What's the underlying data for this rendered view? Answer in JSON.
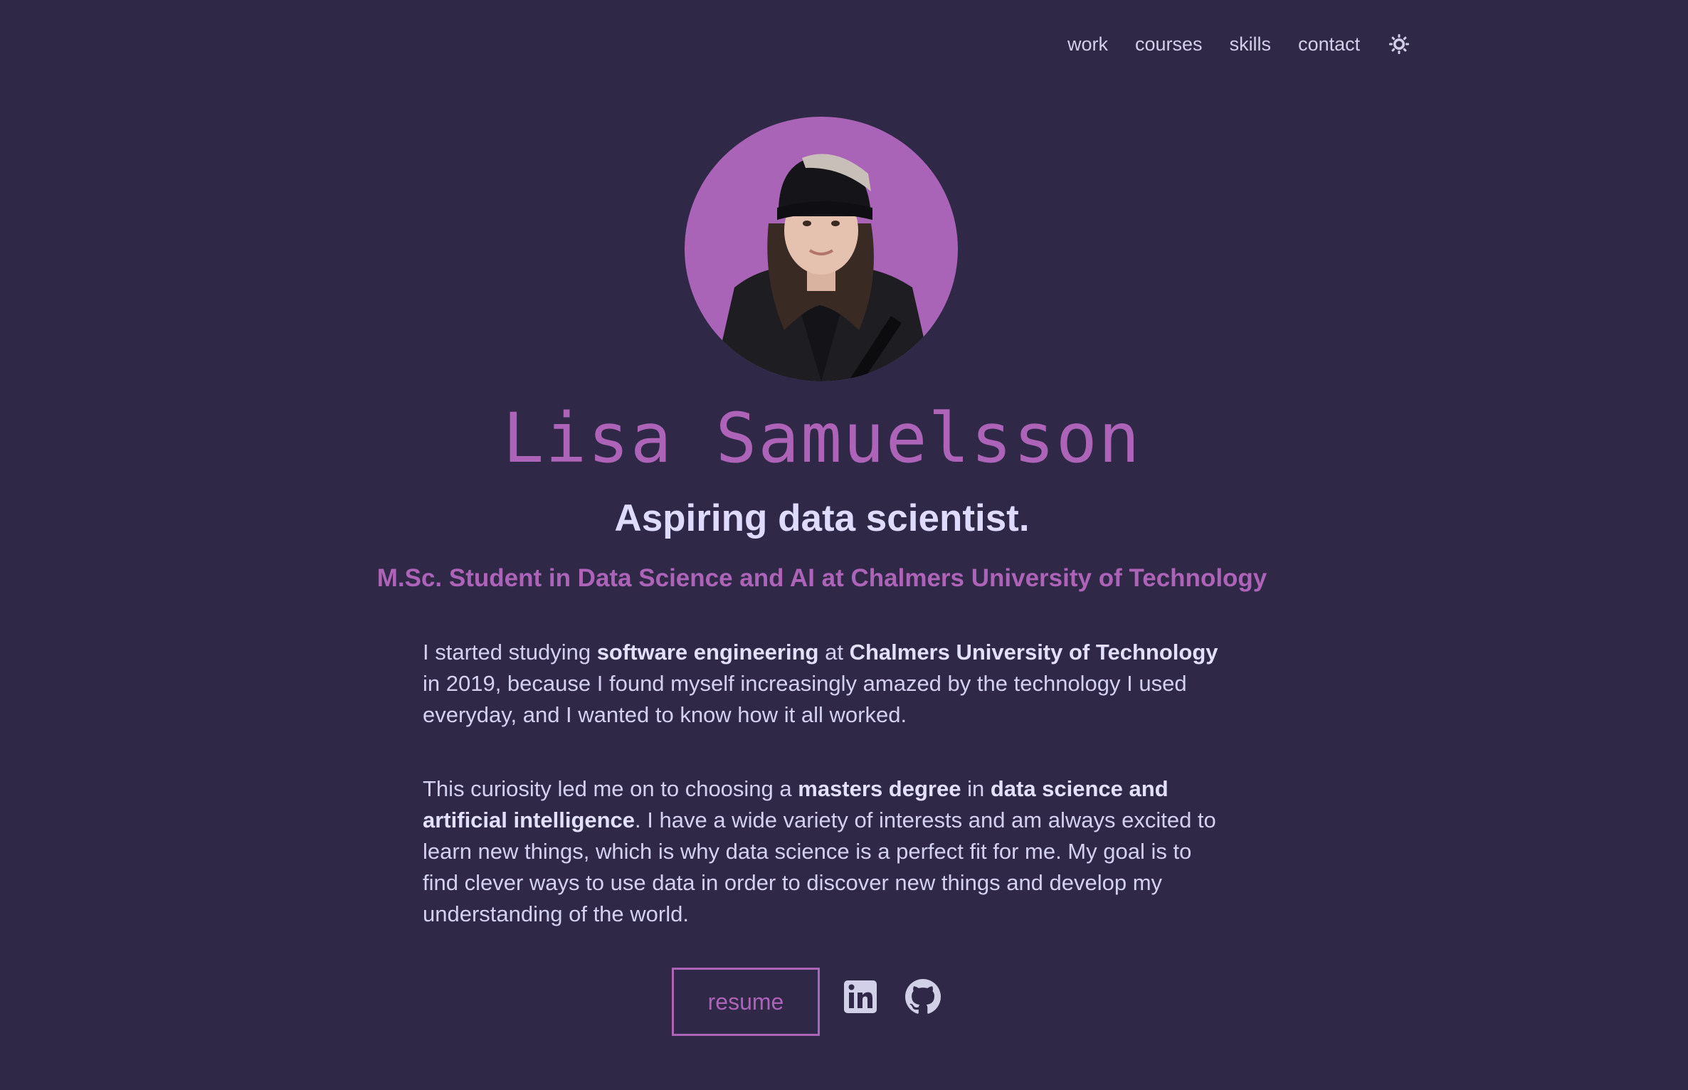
{
  "nav": {
    "items": [
      "work",
      "courses",
      "skills",
      "contact"
    ],
    "theme_icon": "sun-icon"
  },
  "profile": {
    "avatar_icon": "profile-photo",
    "name": "Lisa Samuelsson",
    "tagline": "Aspiring data scientist.",
    "subtitle": "M.Sc. Student in Data Science and AI at Chalmers University of Technology"
  },
  "bio": {
    "p1": [
      {
        "t": "I started studying ",
        "b": false
      },
      {
        "t": "software engineering",
        "b": true
      },
      {
        "t": " at ",
        "b": false
      },
      {
        "t": "Chalmers University of Technology",
        "b": true
      },
      {
        "t": " in 2019, because I found myself increasingly amazed by the technology I used everyday, and I wanted to know how it all worked.",
        "b": false
      }
    ],
    "p2": [
      {
        "t": "This curiosity led me on to choosing a ",
        "b": false
      },
      {
        "t": "masters degree",
        "b": true
      },
      {
        "t": " in ",
        "b": false
      },
      {
        "t": "data science and artificial intelligence",
        "b": true
      },
      {
        "t": ". I have a wide variety of interests and am always excited to learn new things, which is why data science is a perfect fit for me. My goal is to find clever ways to use data in order to discover new things and develop my understanding of the world.",
        "b": false
      }
    ]
  },
  "actions": {
    "resume_label": "resume",
    "linkedin_icon": "linkedin-icon",
    "github_icon": "github-icon"
  },
  "colors": {
    "background": "#2f2847",
    "accent": "#ad63b7",
    "text": "#d4d0ef",
    "heading": "#dedbff"
  }
}
